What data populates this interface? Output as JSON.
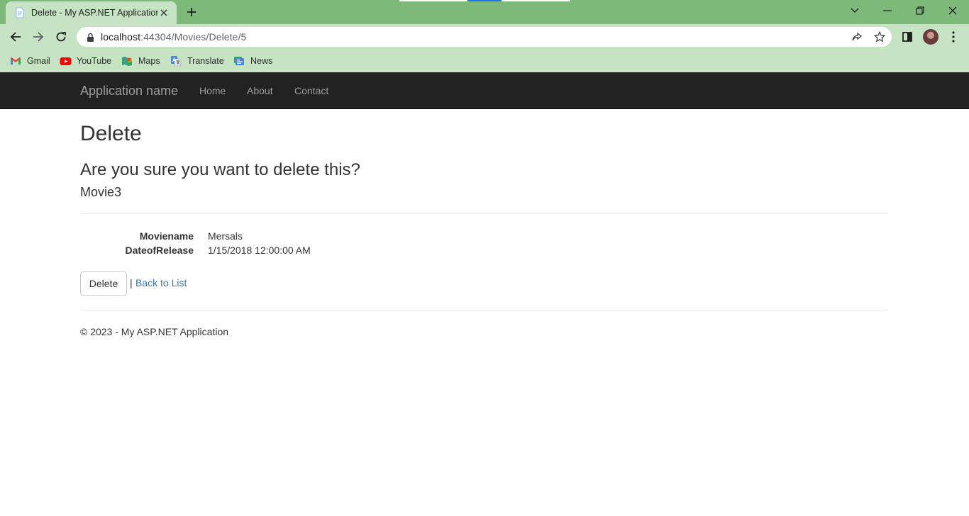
{
  "browser": {
    "tab_title": "Delete - My ASP.NET Application",
    "url_host": "localhost",
    "url_rest": ":44304/Movies/Delete/5",
    "bookmarks": [
      {
        "label": "Gmail",
        "icon": "gmail-icon"
      },
      {
        "label": "YouTube",
        "icon": "youtube-icon"
      },
      {
        "label": "Maps",
        "icon": "maps-icon"
      },
      {
        "label": "Translate",
        "icon": "translate-icon"
      },
      {
        "label": "News",
        "icon": "news-icon"
      }
    ],
    "colors": {
      "tabbar": "#7dba7a",
      "toolbar": "#c6e4c4"
    }
  },
  "site": {
    "brand": "Application name",
    "nav": [
      {
        "label": "Home"
      },
      {
        "label": "About"
      },
      {
        "label": "Contact"
      }
    ],
    "colors": {
      "navbar": "#222222",
      "link": "#337ab7"
    }
  },
  "page": {
    "title": "Delete",
    "confirm": "Are you sure you want to delete this?",
    "entity": "Movie3",
    "fields": [
      {
        "label": "Moviename",
        "value": "Mersals"
      },
      {
        "label": "DateofRelease",
        "value": "1/15/2018 12:00:00 AM"
      }
    ],
    "delete_label": "Delete",
    "separator": "|",
    "back_label": "Back to List",
    "footer": "© 2023 - My ASP.NET Application"
  }
}
